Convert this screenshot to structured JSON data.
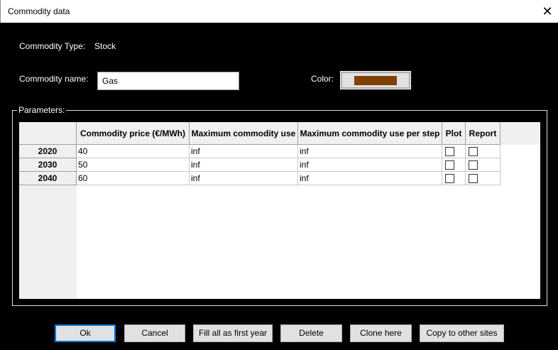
{
  "window": {
    "title": "Commodity data",
    "close_icon": "close-icon"
  },
  "type": {
    "label": "Commodity Type:",
    "value": "Stock"
  },
  "name": {
    "label": "Commodity name:",
    "value": "Gas"
  },
  "color": {
    "label": "Color:",
    "value": "#7f4000"
  },
  "parameters": {
    "label": "Parameters:",
    "columns": [
      "Commodity price (€/MWh)",
      "Maximum commodity use",
      "Maximum commodity use per step",
      "Plot",
      "Report"
    ],
    "rows": [
      {
        "year": "2020",
        "price": "40",
        "max_use": "inf",
        "max_step": "inf",
        "plot": false,
        "report": false
      },
      {
        "year": "2030",
        "price": "50",
        "max_use": "inf",
        "max_step": "inf",
        "plot": false,
        "report": false
      },
      {
        "year": "2040",
        "price": "60",
        "max_use": "inf",
        "max_step": "inf",
        "plot": false,
        "report": false
      }
    ]
  },
  "buttons": {
    "ok": "Ok",
    "cancel": "Cancel",
    "fill": "Fill all as first year",
    "delete": "Delete",
    "clone": "Clone here",
    "copy": "Copy to other sites"
  }
}
